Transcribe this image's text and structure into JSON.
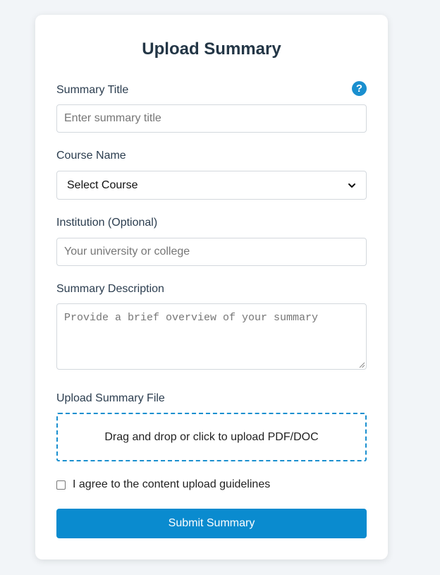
{
  "form": {
    "title": "Upload Summary",
    "summary_title": {
      "label": "Summary Title",
      "placeholder": "Enter summary title",
      "help_icon": "?"
    },
    "course": {
      "label": "Course Name",
      "selected": "Select Course"
    },
    "institution": {
      "label": "Institution (Optional)",
      "placeholder": "Your university or college"
    },
    "description": {
      "label": "Summary Description",
      "placeholder": "Provide a brief overview of your summary"
    },
    "file": {
      "label": "Upload Summary File",
      "dropzone_text": "Drag and drop or click to upload PDF/DOC"
    },
    "agreement": {
      "label": "I agree to the content upload guidelines",
      "checked": false
    },
    "submit_label": "Submit Summary"
  },
  "icons": {
    "help": "question-circle-icon",
    "select": "chevron-down-icon"
  },
  "colors": {
    "accent": "#0a8bcf",
    "title": "#233646",
    "background": "#f2f5f8"
  }
}
